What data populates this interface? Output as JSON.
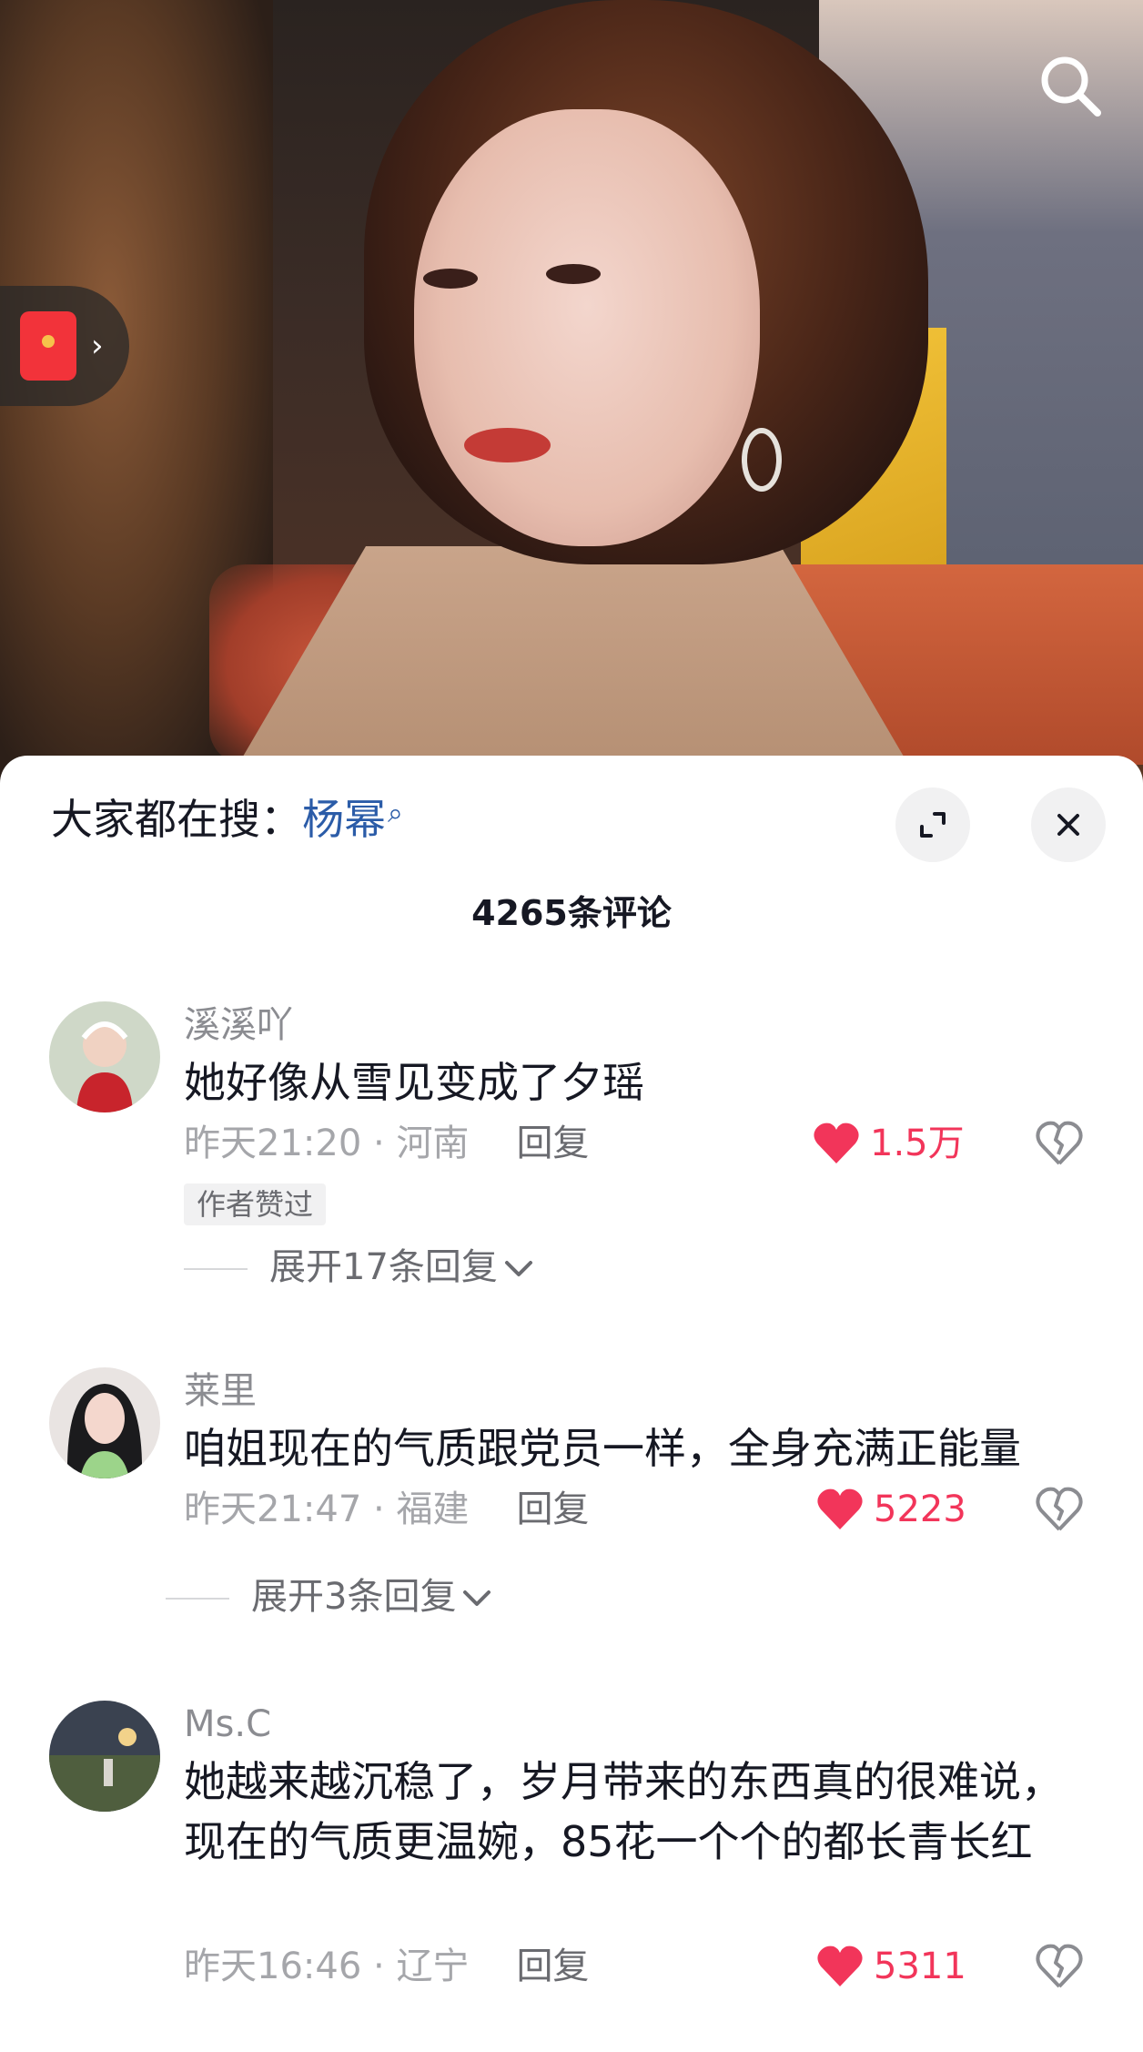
{
  "search_bar": {
    "prefix": "大家都在搜：",
    "keyword": "杨幂"
  },
  "comment_count": "4265条评论",
  "comments": [
    {
      "username": "溪溪吖",
      "text": "她好像从雪见变成了夕瑶",
      "time": "昨天21:20",
      "location": "河南",
      "reply_label": "回复",
      "likes": "1.5万",
      "author_tag": "作者赞过",
      "expand_label": "展开17条回复"
    },
    {
      "username": "莱里",
      "text": "咱姐现在的气质跟党员一样，全身充满正能量",
      "time": "昨天21:47",
      "location": "福建",
      "reply_label": "回复",
      "likes": "5223",
      "expand_label": "展开3条回复"
    },
    {
      "username": "Ms.C",
      "text": "她越来越沉稳了，岁月带来的东西真的很难说，现在的气质更温婉，85花一个个的都长青长红",
      "time": "昨天16:46",
      "location": "辽宁",
      "reply_label": "回复",
      "likes": "5311"
    }
  ],
  "separator": " · ",
  "colors": {
    "like_red": "#f2355a",
    "keyword_blue": "#2b5ca8",
    "muted_gray": "#a5a6aa"
  },
  "icons": [
    "search-icon",
    "red-packet-icon",
    "expand-icon",
    "close-icon",
    "heart-icon",
    "broken-heart-icon",
    "chevron-down-icon"
  ]
}
